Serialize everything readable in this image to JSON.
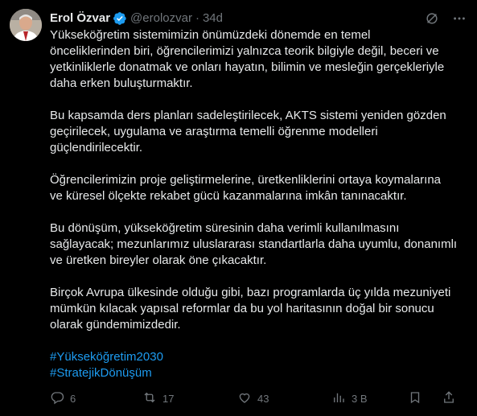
{
  "author": {
    "name": "Erol Özvar",
    "handle": "@erolozvar",
    "separator": "·",
    "time": "34d"
  },
  "icons": {
    "verified": "verified-badge-icon",
    "grok": "grok-icon",
    "more": "more-icon",
    "reply": "reply-icon",
    "retweet": "retweet-icon",
    "like": "heart-icon",
    "views": "views-icon",
    "bookmark": "bookmark-icon",
    "share": "share-icon"
  },
  "colors": {
    "background": "#000000",
    "text": "#e7e9ea",
    "muted": "#71767b",
    "link": "#1d9bf0",
    "verified": "#1d9bf0"
  },
  "tweet": {
    "paragraphs": [
      "Yükseköğretim sistemimizin önümüzdeki dönemde en temel\nönceliklerinden biri, öğrencilerimizi yalnızca teorik bilgiyle değil, beceri ve\nyetkinliklerle donatmak ve onları hayatın, bilimin ve mesleğin gerçekleriyle\ndaha erken buluşturmaktır.",
      "Bu kapsamda ders planları sadeleştirilecek, AKTS sistemi yeniden gözden\ngeçirilecek, uygulama ve araştırma temelli öğrenme modelleri\ngüçlendirilecektir.",
      "Öğrencilerimizin proje geliştirmelerine, üretkenliklerini ortaya koymalarına\nve küresel ölçekte rekabet gücü kazanmalarına imkân tanınacaktır.",
      "Bu dönüşüm, yükseköğretim süresinin daha verimli kullanılmasını\nsağlayacak; mezunlarımız uluslararası standartlarla daha uyumlu, donanımlı\nve üretken bireyler olarak öne çıkacaktır.",
      "Birçok Avrupa ülkesinde olduğu gibi, bazı programlarda üç yılda mezuniyeti\nmümkün kılacak yapısal reformlar da bu yol haritasının doğal bir sonucu\nolarak gündemimizdedir."
    ],
    "hashtags": [
      "#Yükseköğretim2030",
      "#StratejikDönüşüm"
    ]
  },
  "stats": {
    "replies": "6",
    "retweets": "17",
    "likes": "43",
    "views": "3 B"
  }
}
